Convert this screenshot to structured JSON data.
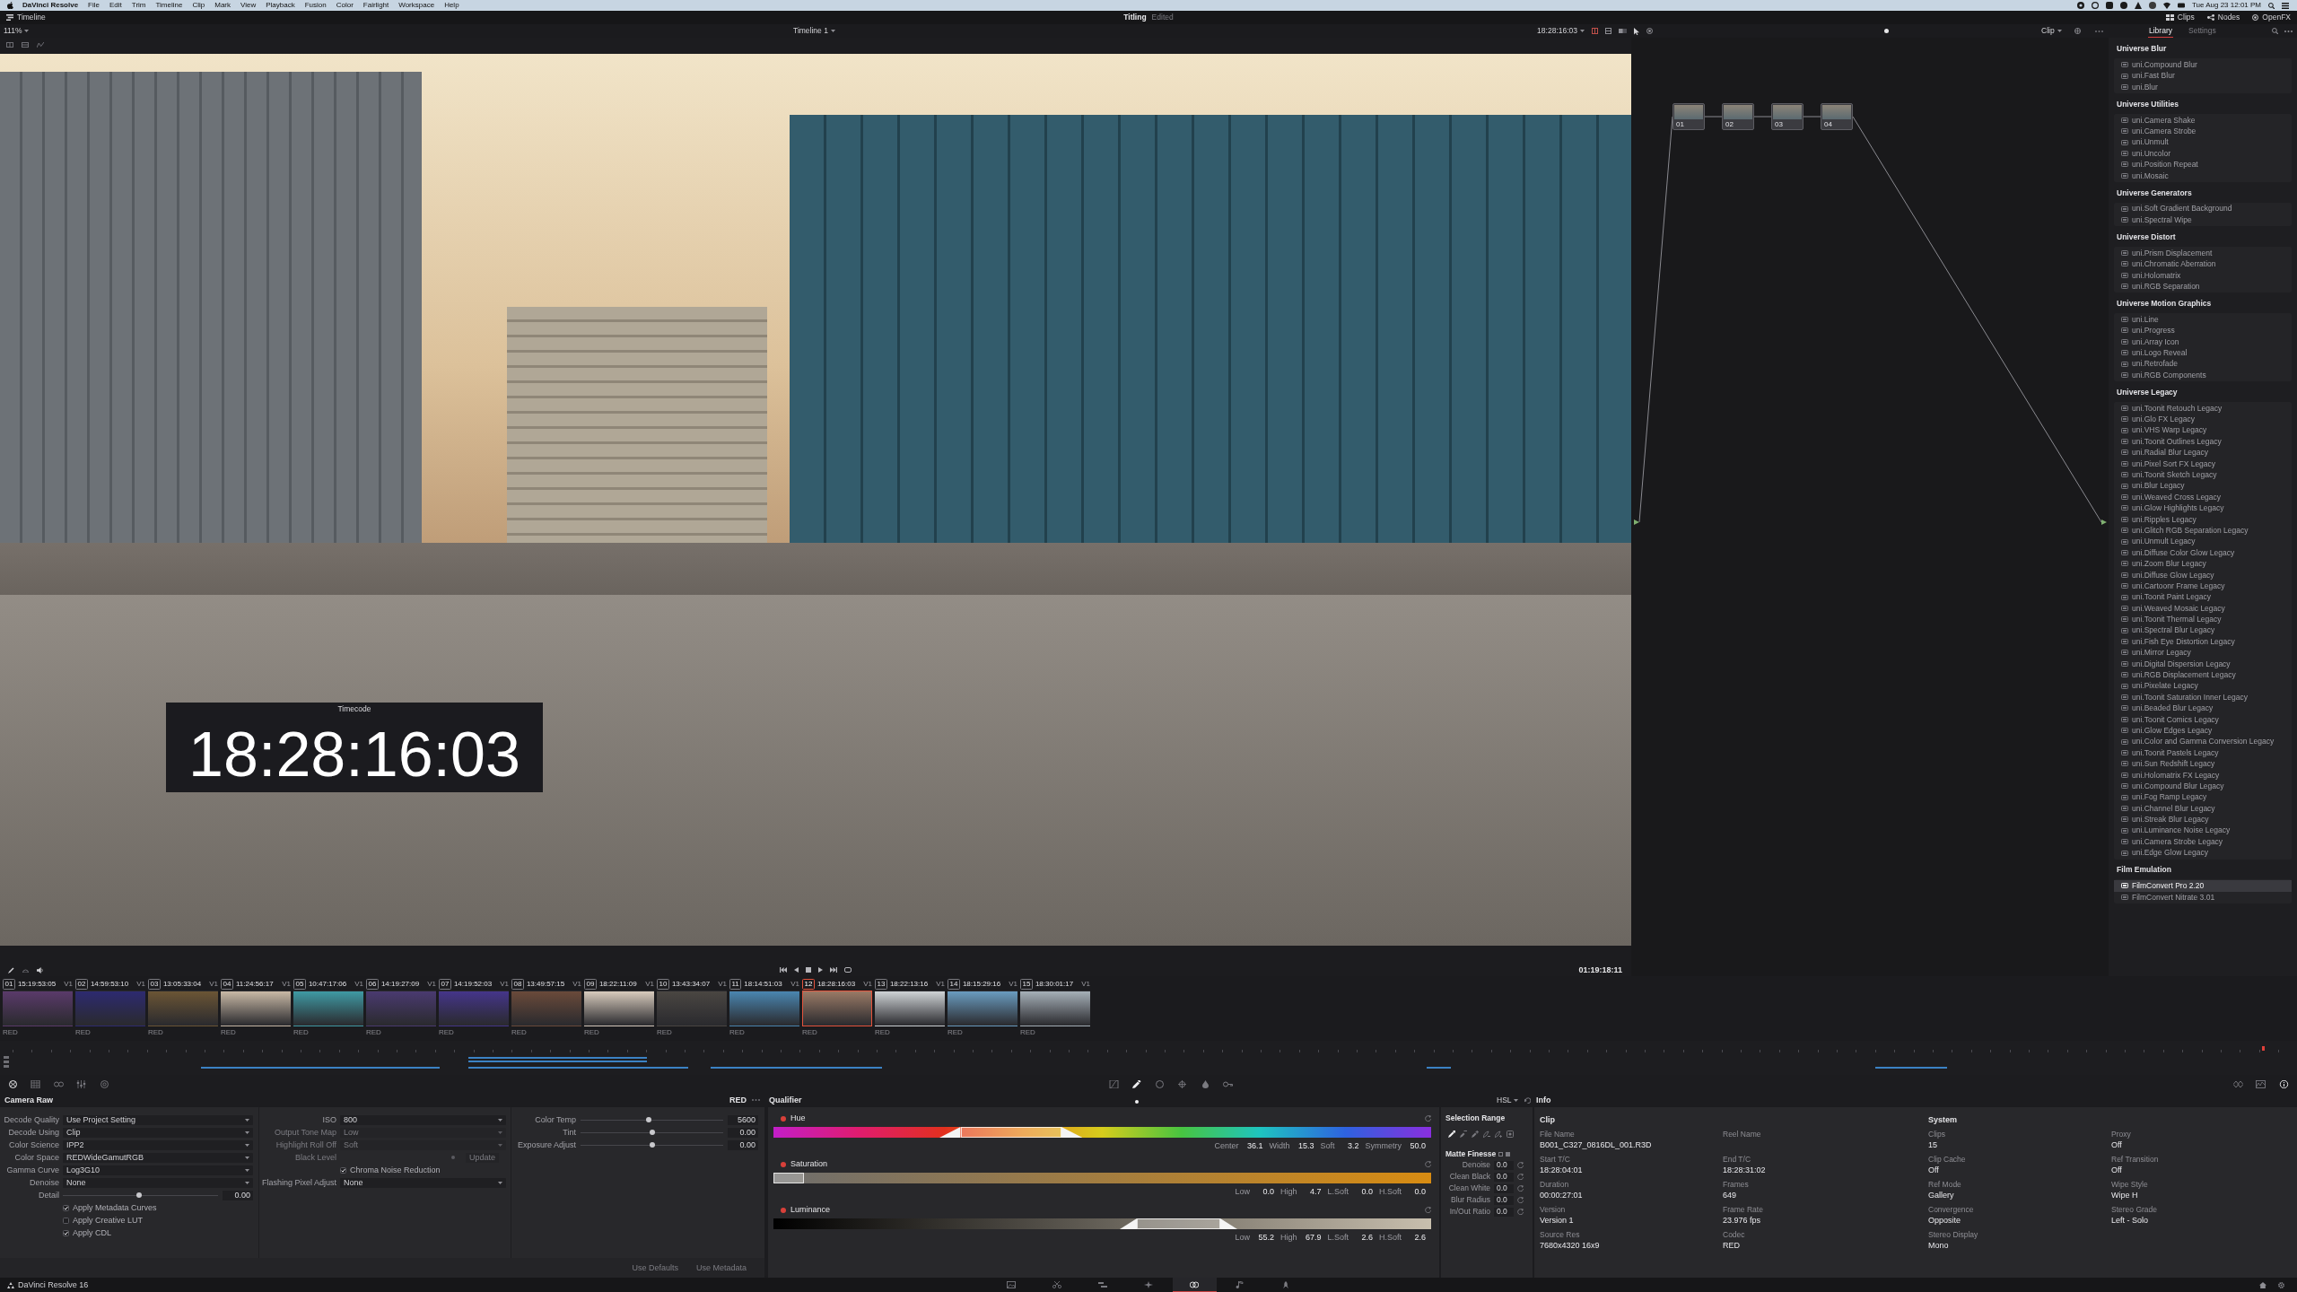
{
  "menubar": {
    "app": "DaVinci Resolve",
    "menus": [
      "File",
      "Edit",
      "Trim",
      "Timeline",
      "Clip",
      "Mark",
      "View",
      "Playback",
      "Fusion",
      "Color",
      "Fairlight",
      "Workspace",
      "Help"
    ],
    "clock": "Tue Aug 23 12:01 PM"
  },
  "titlebar": {
    "workspace": "Timeline",
    "project": "Titling",
    "status": "Edited",
    "toggles": [
      {
        "kind": "clips",
        "label": "Clips"
      },
      {
        "kind": "nodes",
        "label": "Nodes"
      },
      {
        "kind": "openfx",
        "label": "OpenFX"
      }
    ]
  },
  "toolbar": {
    "zoom": "111%",
    "timeline": "Timeline 1",
    "timecode": "18:28:16:03",
    "node_mode": "Clip",
    "tabs": [
      {
        "label": "Library",
        "selected": true
      },
      {
        "label": "Settings",
        "selected": false
      }
    ]
  },
  "viewer": {
    "overlay": {
      "title": "Timecode",
      "timecode": "18:28:16:03"
    },
    "timecode": "01:19:18:11"
  },
  "nodes": [
    {
      "label": "01"
    },
    {
      "label": "02"
    },
    {
      "label": "03"
    },
    {
      "label": "04"
    }
  ],
  "library": {
    "sections": [
      {
        "title": "Universe Blur",
        "items": [
          {
            "label": "uni.Compound Blur",
            "selected": false
          },
          {
            "label": "uni.Fast Blur",
            "selected": false
          },
          {
            "label": "uni.Blur",
            "selected": false
          }
        ]
      },
      {
        "title": "Universe Utilities",
        "items": [
          {
            "label": "uni.Camera Shake",
            "selected": false
          },
          {
            "label": "uni.Camera Strobe",
            "selected": false
          },
          {
            "label": "uni.Unmult",
            "selected": false
          },
          {
            "label": "uni.Uncolor",
            "selected": false
          },
          {
            "label": "uni.Position Repeat",
            "selected": false
          },
          {
            "label": "uni.Mosaic",
            "selected": false
          }
        ]
      },
      {
        "title": "Universe Generators",
        "items": [
          {
            "label": "uni.Soft Gradient Background",
            "selected": false
          },
          {
            "label": "uni.Spectral Wipe",
            "selected": false
          }
        ]
      },
      {
        "title": "Universe Distort",
        "items": [
          {
            "label": "uni.Prism Displacement",
            "selected": false
          },
          {
            "label": "uni.Chromatic Aberration",
            "selected": false
          },
          {
            "label": "uni.Holomatrix",
            "selected": false
          },
          {
            "label": "uni.RGB Separation",
            "selected": false
          }
        ]
      },
      {
        "title": "Universe Motion Graphics",
        "items": [
          {
            "label": "uni.Line",
            "selected": false
          },
          {
            "label": "uni.Progress",
            "selected": false
          },
          {
            "label": "uni.Array Icon",
            "selected": false
          },
          {
            "label": "uni.Logo Reveal",
            "selected": false
          },
          {
            "label": "uni.Retrofade",
            "selected": false
          },
          {
            "label": "uni.RGB Components",
            "selected": false
          }
        ]
      },
      {
        "title": "Universe Legacy",
        "items": [
          {
            "label": "uni.Toonit Retouch Legacy",
            "selected": false
          },
          {
            "label": "uni.Glo FX Legacy",
            "selected": false
          },
          {
            "label": "uni.VHS Warp Legacy",
            "selected": false
          },
          {
            "label": "uni.Toonit Outlines Legacy",
            "selected": false
          },
          {
            "label": "uni.Radial Blur Legacy",
            "selected": false
          },
          {
            "label": "uni.Pixel Sort FX Legacy",
            "selected": false
          },
          {
            "label": "uni.Toonit Sketch Legacy",
            "selected": false
          },
          {
            "label": "uni.Blur Legacy",
            "selected": false
          },
          {
            "label": "uni.Weaved Cross Legacy",
            "selected": false
          },
          {
            "label": "uni.Glow Highlights Legacy",
            "selected": false
          },
          {
            "label": "uni.Ripples Legacy",
            "selected": false
          },
          {
            "label": "uni.Glitch RGB Separation Legacy",
            "selected": false
          },
          {
            "label": "uni.Unmult Legacy",
            "selected": false
          },
          {
            "label": "uni.Diffuse Color Glow Legacy",
            "selected": false
          },
          {
            "label": "uni.Zoom Blur Legacy",
            "selected": false
          },
          {
            "label": "uni.Diffuse Glow Legacy",
            "selected": false
          },
          {
            "label": "uni.Cartoonr Frame Legacy",
            "selected": false
          },
          {
            "label": "uni.Toonit Paint Legacy",
            "selected": false
          },
          {
            "label": "uni.Weaved Mosaic Legacy",
            "selected": false
          },
          {
            "label": "uni.Toonit Thermal Legacy",
            "selected": false
          },
          {
            "label": "uni.Spectral Blur Legacy",
            "selected": false
          },
          {
            "label": "uni.Fish Eye Distortion Legacy",
            "selected": false
          },
          {
            "label": "uni.Mirror Legacy",
            "selected": false
          },
          {
            "label": "uni.Digital Dispersion Legacy",
            "selected": false
          },
          {
            "label": "uni.RGB Displacement Legacy",
            "selected": false
          },
          {
            "label": "uni.Pixelate Legacy",
            "selected": false
          },
          {
            "label": "uni.Toonit Saturation Inner Legacy",
            "selected": false
          },
          {
            "label": "uni.Beaded Blur Legacy",
            "selected": false
          },
          {
            "label": "uni.Toonit Comics Legacy",
            "selected": false
          },
          {
            "label": "uni.Glow Edges Legacy",
            "selected": false
          },
          {
            "label": "uni.Color and Gamma Conversion Legacy",
            "selected": false
          },
          {
            "label": "uni.Toonit Pastels Legacy",
            "selected": false
          },
          {
            "label": "uni.Sun Redshift Legacy",
            "selected": false
          },
          {
            "label": "uni.Holomatrix FX Legacy",
            "selected": false
          },
          {
            "label": "uni.Compound Blur Legacy",
            "selected": false
          },
          {
            "label": "uni.Fog Ramp Legacy",
            "selected": false
          },
          {
            "label": "uni.Channel Blur Legacy",
            "selected": false
          },
          {
            "label": "uni.Streak Blur Legacy",
            "selected": false
          },
          {
            "label": "uni.Luminance Noise Legacy",
            "selected": false
          },
          {
            "label": "uni.Camera Strobe Legacy",
            "selected": false
          },
          {
            "label": "uni.Edge Glow Legacy",
            "selected": false
          }
        ]
      },
      {
        "title": "Film Emulation",
        "items": [
          {
            "label": "FilmConvert Pro 2.20",
            "selected": true
          },
          {
            "label": "FilmConvert Nitrate 3.01",
            "selected": false
          }
        ]
      }
    ]
  },
  "clips": [
    {
      "number": "01",
      "timecode": "15:19:53:05",
      "track": "V1",
      "codec": "RED",
      "selected": false
    },
    {
      "number": "02",
      "timecode": "14:59:53:10",
      "track": "V1",
      "codec": "RED",
      "selected": false
    },
    {
      "number": "03",
      "timecode": "13:05:33:04",
      "track": "V1",
      "codec": "RED",
      "selected": false
    },
    {
      "number": "04",
      "timecode": "11:24:56:17",
      "track": "V1",
      "codec": "RED",
      "selected": false
    },
    {
      "number": "05",
      "timecode": "10:47:17:06",
      "track": "V1",
      "codec": "RED",
      "selected": false
    },
    {
      "number": "06",
      "timecode": "14:19:27:09",
      "track": "V1",
      "codec": "RED",
      "selected": false
    },
    {
      "number": "07",
      "timecode": "14:19:52:03",
      "track": "V1",
      "codec": "RED",
      "selected": false
    },
    {
      "number": "08",
      "timecode": "13:49:57:15",
      "track": "V1",
      "codec": "RED",
      "selected": false
    },
    {
      "number": "09",
      "timecode": "18:22:11:09",
      "track": "V1",
      "codec": "RED",
      "selected": false
    },
    {
      "number": "10",
      "timecode": "13:43:34:07",
      "track": "V1",
      "codec": "RED",
      "selected": false
    },
    {
      "number": "11",
      "timecode": "18:14:51:03",
      "track": "V1",
      "codec": "RED",
      "selected": false
    },
    {
      "number": "12",
      "timecode": "18:28:16:03",
      "track": "V1",
      "codec": "RED",
      "selected": true
    },
    {
      "number": "13",
      "timecode": "18:22:13:16",
      "track": "V1",
      "codec": "RED",
      "selected": false
    },
    {
      "number": "14",
      "timecode": "18:15:29:16",
      "track": "V1",
      "codec": "RED",
      "selected": false
    },
    {
      "number": "15",
      "timecode": "18:30:01:17",
      "track": "V1",
      "codec": "RED",
      "selected": false
    }
  ],
  "palette": {
    "left": [
      {
        "kind": "camera_raw",
        "selected": true
      },
      {
        "kind": "color_match",
        "selected": false
      },
      {
        "kind": "wheels",
        "selected": false
      },
      {
        "kind": "mixer",
        "selected": false
      },
      {
        "kind": "motion",
        "selected": false
      }
    ],
    "center": [
      {
        "kind": "curves",
        "selected": false
      },
      {
        "kind": "qualifier",
        "selected": true
      },
      {
        "kind": "window",
        "selected": false
      },
      {
        "kind": "tracker",
        "selected": false
      },
      {
        "kind": "blur",
        "selected": false
      },
      {
        "kind": "key",
        "selected": false
      }
    ],
    "right": [
      {
        "kind": "keyframes",
        "selected": false
      },
      {
        "kind": "scopes",
        "selected": false
      },
      {
        "kind": "info",
        "selected": true
      }
    ]
  },
  "camera_raw": {
    "title": "Camera Raw",
    "format": "RED",
    "columns": [
      [
        {
          "kind": "dropdown",
          "label": "Decode Quality",
          "value": "Use Project Setting",
          "disabled": false
        },
        {
          "kind": "dropdown",
          "label": "Decode Using",
          "value": "Clip",
          "disabled": false
        },
        {
          "kind": "dropdown",
          "label": "Color Science",
          "value": "IPP2",
          "disabled": false
        },
        {
          "kind": "dropdown",
          "label": "Color Space",
          "value": "REDWideGamutRGB",
          "disabled": false
        },
        {
          "kind": "dropdown",
          "label": "Gamma Curve",
          "value": "Log3G10",
          "disabled": false
        },
        {
          "kind": "dropdown",
          "label": "Denoise",
          "value": "None",
          "disabled": false
        },
        {
          "kind": "slider",
          "label": "Detail",
          "value": "0.00",
          "level": 0.49
        },
        {
          "kind": "checkbox",
          "label": "Apply Metadata Curves",
          "checked": true
        },
        {
          "kind": "checkbox",
          "label": "Apply Creative LUT",
          "checked": false
        },
        {
          "kind": "checkbox",
          "label": "Apply CDL",
          "checked": true
        }
      ],
      [
        {
          "kind": "dropdown",
          "label": "ISO",
          "value": "800",
          "disabled": false
        },
        {
          "kind": "dropdown",
          "label": "Output Tone Map",
          "value": "Low",
          "disabled": true
        },
        {
          "kind": "dropdown",
          "label": "Highlight Roll Off",
          "value": "Soft",
          "disabled": true
        },
        {
          "kind": "action",
          "label": "Black Level",
          "button": "Update",
          "disabled": true
        },
        {
          "kind": "checkbox",
          "label": "Chroma Noise Reduction",
          "checked": true
        },
        {
          "kind": "dropdown",
          "label": "Flashing Pixel Adjust",
          "value": "None",
          "disabled": false
        }
      ],
      [
        {
          "kind": "slider",
          "label": "Color Temp",
          "value": "5600",
          "level": 0.48
        },
        {
          "kind": "slider",
          "label": "Tint",
          "value": "0.00",
          "level": 0.5
        },
        {
          "kind": "slider",
          "label": "Exposure Adjust",
          "value": "0.00",
          "level": 0.5
        }
      ]
    ],
    "buttons": [
      {
        "label": "Use Defaults",
        "disabled": true
      },
      {
        "label": "Use Metadata",
        "disabled": true
      }
    ]
  },
  "qualifier": {
    "title": "Qualifier",
    "mode": "HSL",
    "channels": [
      {
        "kind": "hue",
        "label": "Hue",
        "enabled": true,
        "params": [
          {
            "label": "Center",
            "value": "36.1"
          },
          {
            "label": "Width",
            "value": "15.3"
          },
          {
            "label": "Soft",
            "value": "3.2"
          },
          {
            "label": "Symmetry",
            "value": "50.0"
          }
        ]
      },
      {
        "kind": "saturation",
        "label": "Saturation",
        "enabled": true,
        "params": [
          {
            "label": "Low",
            "value": "0.0"
          },
          {
            "label": "High",
            "value": "4.7"
          },
          {
            "label": "L.Soft",
            "value": "0.0"
          },
          {
            "label": "H.Soft",
            "value": "0.0"
          }
        ]
      },
      {
        "kind": "luminance",
        "label": "Luminance",
        "enabled": true,
        "params": [
          {
            "label": "Low",
            "value": "55.2"
          },
          {
            "label": "High",
            "value": "67.9"
          },
          {
            "label": "L.Soft",
            "value": "2.6"
          },
          {
            "label": "H.Soft",
            "value": "2.6"
          }
        ]
      }
    ]
  },
  "selection_range": {
    "title": "Selection Range",
    "tools": [
      {
        "kind": "picker",
        "selected": true
      },
      {
        "kind": "picker_minus",
        "selected": false
      },
      {
        "kind": "picker_plus",
        "selected": false
      },
      {
        "kind": "feather_minus",
        "selected": false
      },
      {
        "kind": "feather_plus",
        "selected": false
      },
      {
        "kind": "highlight",
        "selected": false
      }
    ],
    "matte_finesse": {
      "title": "Matte Finesse",
      "params": [
        {
          "label": "Denoise",
          "value": "0.0"
        },
        {
          "label": "Clean Black",
          "value": "0.0"
        },
        {
          "label": "Clean White",
          "value": "0.0"
        },
        {
          "label": "Blur Radius",
          "value": "0.0"
        },
        {
          "label": "In/Out Ratio",
          "value": "0.0"
        }
      ]
    }
  },
  "info": {
    "title": "Info",
    "groups": [
      {
        "title": "Clip",
        "fields": [
          {
            "label": "File Name",
            "value": "B001_C327_0816DL_001.R3D"
          },
          {
            "label": "Reel Name"
          },
          {
            "label": "Start T/C",
            "value": "18:28:04:01"
          },
          {
            "label": "End T/C",
            "value": "18:28:31:02"
          },
          {
            "label": "Duration",
            "value": "00:00:27:01"
          },
          {
            "label": "Frames",
            "value": "649"
          },
          {
            "label": "Version",
            "value": "Version 1"
          },
          {
            "label": "Frame Rate",
            "value": "23.976 fps"
          },
          {
            "label": "Source Res",
            "value": "7680x4320 16x9"
          },
          {
            "label": "Codec",
            "value": "RED"
          }
        ]
      },
      {
        "title": "System",
        "fields": [
          {
            "label": "Clips",
            "value": "15"
          },
          {
            "label": "Proxy",
            "value": "Off"
          },
          {
            "label": "Clip Cache",
            "value": "Off"
          },
          {
            "label": "Ref Transition",
            "value": "Off"
          },
          {
            "label": "Ref Mode",
            "value": "Gallery"
          },
          {
            "label": "Wipe Style",
            "value": "Wipe H"
          },
          {
            "label": "Convergence",
            "value": "Opposite"
          },
          {
            "label": "Stereo Grade",
            "value": "Left - Solo"
          },
          {
            "label": "Stereo Display",
            "value": "Mono"
          }
        ]
      }
    ]
  },
  "status_bar": {
    "app": "DaVinci Resolve 16",
    "pages": [
      {
        "kind": "media",
        "selected": false
      },
      {
        "kind": "cut",
        "selected": false
      },
      {
        "kind": "edit",
        "selected": false
      },
      {
        "kind": "fusion",
        "selected": false
      },
      {
        "kind": "color",
        "selected": true
      },
      {
        "kind": "fairlight",
        "selected": false
      },
      {
        "kind": "deliver",
        "selected": false
      }
    ]
  }
}
